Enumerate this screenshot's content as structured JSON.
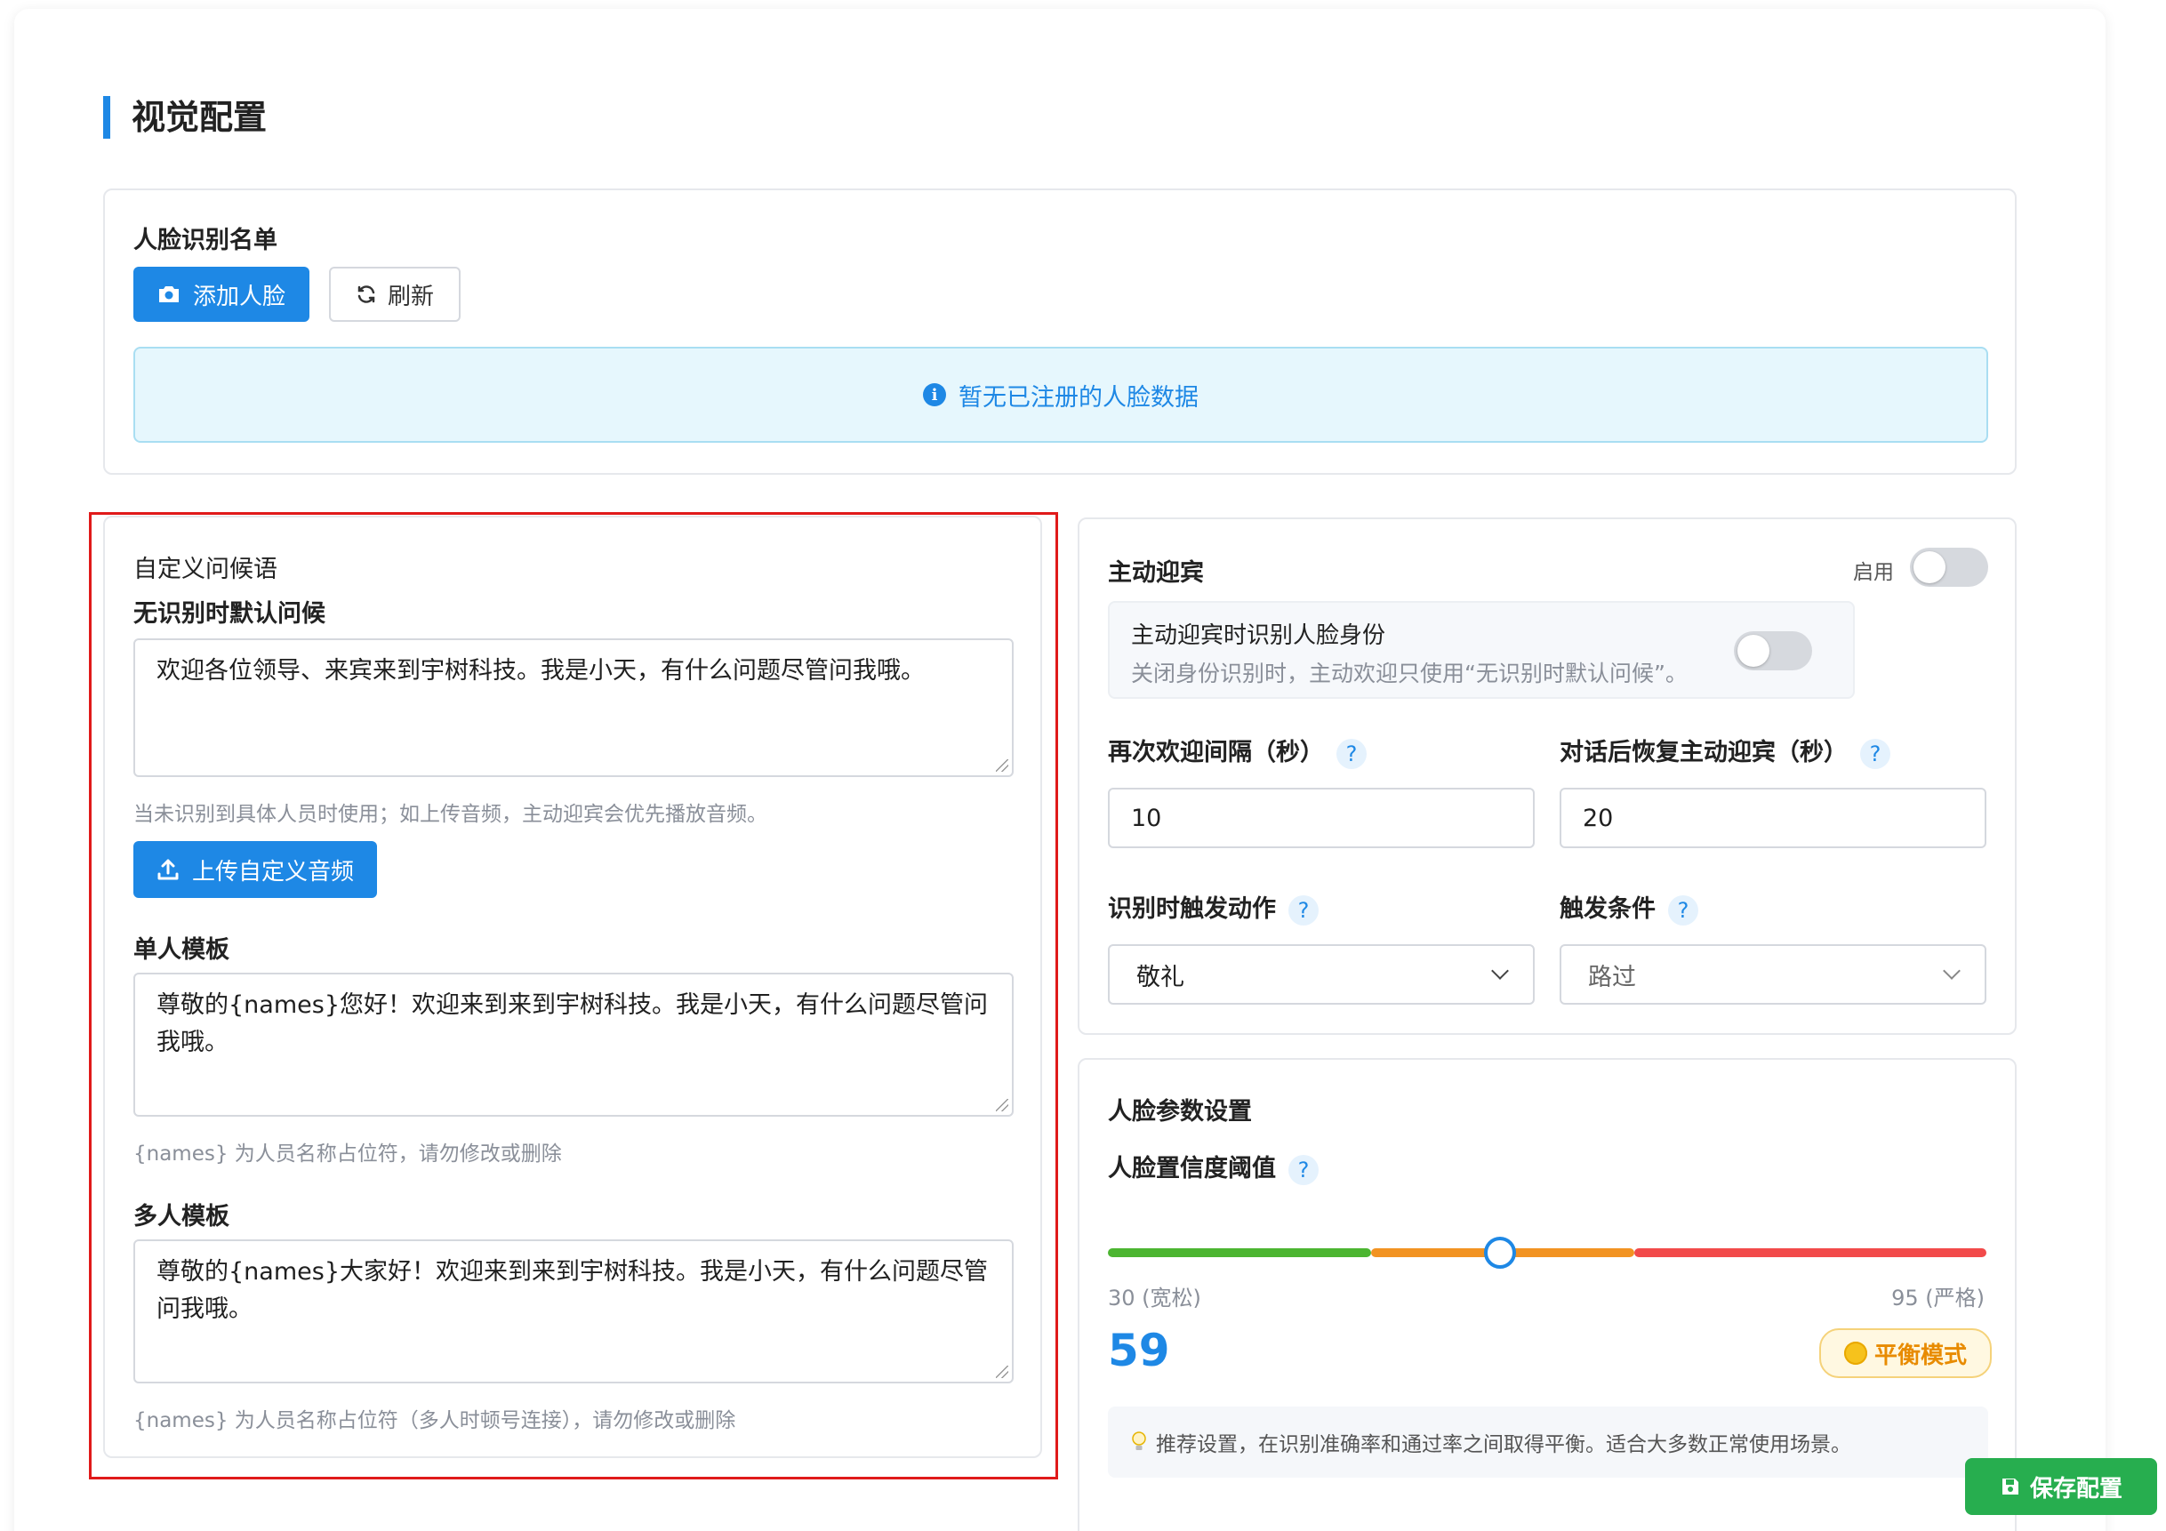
{
  "section_title": "视觉配置",
  "face_list": {
    "title": "人脸识别名单",
    "add_button": "添加人脸",
    "refresh_button": "刷新",
    "empty_notice": "暂无已注册的人脸数据"
  },
  "greeting": {
    "title": "自定义问候语",
    "default_label": "无识别时默认问候",
    "default_value": "欢迎各位领导、来宾来到宇树科技。我是小天，有什么问题尽管问我哦。",
    "default_hint": "当未识别到具体人员时使用；如上传音频，主动迎宾会优先播放音频。",
    "upload_button": "上传自定义音频",
    "single_label": "单人模板",
    "single_value": "尊敬的{names}您好！欢迎来到来到宇树科技。我是小天，有什么问题尽管问我哦。",
    "single_hint": "{names} 为人员名称占位符，请勿修改或删除",
    "multi_label": "多人模板",
    "multi_value": "尊敬的{names}大家好！欢迎来到来到宇树科技。我是小天，有什么问题尽管问我哦。",
    "multi_hint": "{names} 为人员名称占位符（多人时顿号连接），请勿修改或删除"
  },
  "welcome": {
    "title": "主动迎宾",
    "enable_label": "启用",
    "enabled": false,
    "identify_title": "主动迎宾时识别人脸身份",
    "identify_desc": "关闭身份识别时，主动欢迎只使用“无识别时默认问候”。",
    "identify_enabled": false,
    "interval_label": "再次欢迎间隔（秒）",
    "interval_value": "10",
    "resume_label": "对话后恢复主动迎宾（秒）",
    "resume_value": "20",
    "action_label": "识别时触发动作",
    "action_value": "敬礼",
    "condition_label": "触发条件",
    "condition_value": "路过",
    "help_glyph": "?"
  },
  "face_params": {
    "title": "人脸参数设置",
    "threshold_label": "人脸置信度阈值",
    "min_label": "30 (宽松)",
    "max_label": "95 (严格)",
    "min": 30,
    "max": 95,
    "value": 59,
    "value_text": "59",
    "mode_label": "平衡模式",
    "tip": "推荐设置，在识别准确率和通过率之间取得平衡。适合大多数正常使用场景。",
    "colors": {
      "low": "#4cb531",
      "mid": "#f29322",
      "high": "#f24a4a",
      "accent": "#1e88e5"
    }
  },
  "save_button": "保存配置"
}
